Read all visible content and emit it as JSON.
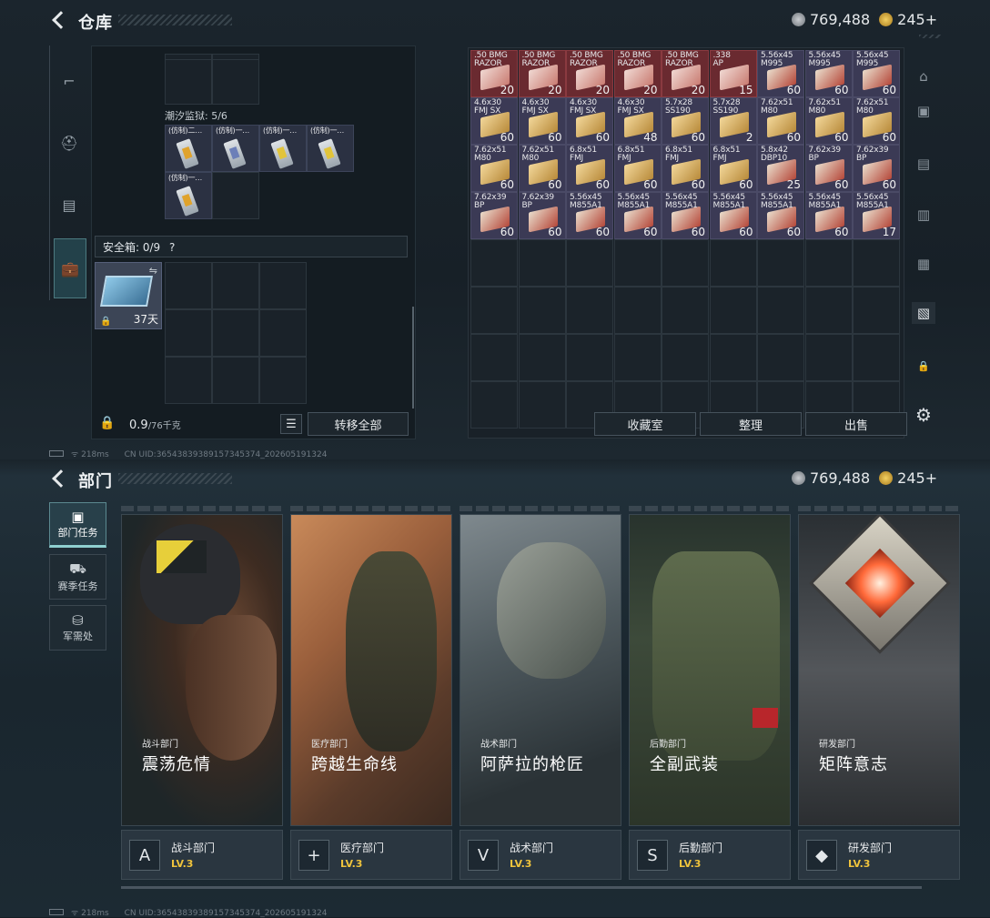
{
  "screen1": {
    "title": "仓库",
    "currency": {
      "amount": "769,488",
      "premium": "245",
      "plus": "+"
    },
    "sidebar_icons": [
      "rifle-icon",
      "helmet-icon",
      "vest-icon",
      "briefcase-icon"
    ],
    "tidal_prison_label": "潮汐监狱: 5/6",
    "tidal_items": [
      "(仿制)二…",
      "(仿制)一…",
      "(仿制)一…",
      "(仿制)一…",
      "(仿制)一…"
    ],
    "safe_box_label": "安全箱: 0/9",
    "safe_help": "?",
    "safe_days": "37天",
    "weight": "0.9",
    "weight_max": "/76千克",
    "transfer_all": "转移全部",
    "buttons": {
      "collection": "收藏室",
      "organize": "整理",
      "sell": "出售"
    },
    "ammo": [
      {
        "label": ".50 BMG\nRAZOR",
        "qty": "20",
        "red": true
      },
      {
        "label": ".50 BMG\nRAZOR",
        "qty": "20",
        "red": true
      },
      {
        "label": ".50 BMG\nRAZOR",
        "qty": "20",
        "red": true
      },
      {
        "label": ".50 BMG\nRAZOR",
        "qty": "20",
        "red": true
      },
      {
        "label": ".50 BMG\nRAZOR",
        "qty": "20",
        "red": true
      },
      {
        "label": ".338\nAP",
        "qty": "15",
        "red": true
      },
      {
        "label": "5.56x45\nM995",
        "qty": "60",
        "red": false
      },
      {
        "label": "5.56x45\nM995",
        "qty": "60",
        "red": false
      },
      {
        "label": "5.56x45\nM995",
        "qty": "60",
        "red": false
      },
      {
        "label": "4.6x30\nFMJ SX",
        "qty": "60",
        "red": false
      },
      {
        "label": "4.6x30\nFMJ SX",
        "qty": "60",
        "red": false
      },
      {
        "label": "4.6x30\nFMJ SX",
        "qty": "60",
        "red": false
      },
      {
        "label": "4.6x30\nFMJ SX",
        "qty": "48",
        "red": false
      },
      {
        "label": "5.7x28\nSS190",
        "qty": "60",
        "red": false
      },
      {
        "label": "5.7x28\nSS190",
        "qty": "2",
        "red": false
      },
      {
        "label": "7.62x51\nM80",
        "qty": "60",
        "red": false
      },
      {
        "label": "7.62x51\nM80",
        "qty": "60",
        "red": false
      },
      {
        "label": "7.62x51\nM80",
        "qty": "60",
        "red": false
      },
      {
        "label": "7.62x51\nM80",
        "qty": "60",
        "red": false
      },
      {
        "label": "7.62x51\nM80",
        "qty": "60",
        "red": false
      },
      {
        "label": "6.8x51\nFMJ",
        "qty": "60",
        "red": false
      },
      {
        "label": "6.8x51\nFMJ",
        "qty": "60",
        "red": false
      },
      {
        "label": "6.8x51\nFMJ",
        "qty": "60",
        "red": false
      },
      {
        "label": "6.8x51\nFMJ",
        "qty": "60",
        "red": false
      },
      {
        "label": "5.8x42\nDBP10",
        "qty": "25",
        "red": false
      },
      {
        "label": "7.62x39\nBP",
        "qty": "60",
        "red": false
      },
      {
        "label": "7.62x39\nBP",
        "qty": "60",
        "red": false
      },
      {
        "label": "7.62x39\nBP",
        "qty": "60",
        "red": false
      },
      {
        "label": "7.62x39\nBP",
        "qty": "60",
        "red": false
      },
      {
        "label": "5.56x45\nM855A1",
        "qty": "60",
        "red": false
      },
      {
        "label": "5.56x45\nM855A1",
        "qty": "60",
        "red": false
      },
      {
        "label": "5.56x45\nM855A1",
        "qty": "60",
        "red": false
      },
      {
        "label": "5.56x45\nM855A1",
        "qty": "60",
        "red": false
      },
      {
        "label": "5.56x45\nM855A1",
        "qty": "60",
        "red": false
      },
      {
        "label": "5.56x45\nM855A1",
        "qty": "60",
        "red": false
      },
      {
        "label": "5.56x45\nM855A1",
        "qty": "17",
        "red": false
      }
    ],
    "status": {
      "ping": "218ms",
      "uid": "CN UID:3654383938915734537​4_202605191324"
    }
  },
  "screen2": {
    "title": "部门",
    "currency": {
      "amount": "769,488",
      "premium": "245",
      "plus": "+"
    },
    "nav": [
      {
        "label": "部门任务",
        "selected": true
      },
      {
        "label": "赛季任务",
        "selected": false
      },
      {
        "label": "军需处",
        "selected": false
      }
    ],
    "cards": [
      {
        "dept": "战斗部门",
        "name": "震荡危情",
        "lv_dept": "战斗部门",
        "lv": "LV.3",
        "icon": "A"
      },
      {
        "dept": "医疗部门",
        "name": "跨越生命线",
        "lv_dept": "医疗部门",
        "lv": "LV.3",
        "icon": "+"
      },
      {
        "dept": "战术部门",
        "name": "阿萨拉的枪匠",
        "lv_dept": "战术部门",
        "lv": "LV.3",
        "icon": "V"
      },
      {
        "dept": "后勤部门",
        "name": "全副武装",
        "lv_dept": "后勤部门",
        "lv": "LV.3",
        "icon": "S"
      },
      {
        "dept": "研发部门",
        "name": "矩阵意志",
        "lv_dept": "研发部门",
        "lv": "LV.3",
        "icon": "◆"
      }
    ],
    "status": {
      "ping": "218ms",
      "uid": "CN UID:3654383938915734537​4_202605191324"
    }
  }
}
